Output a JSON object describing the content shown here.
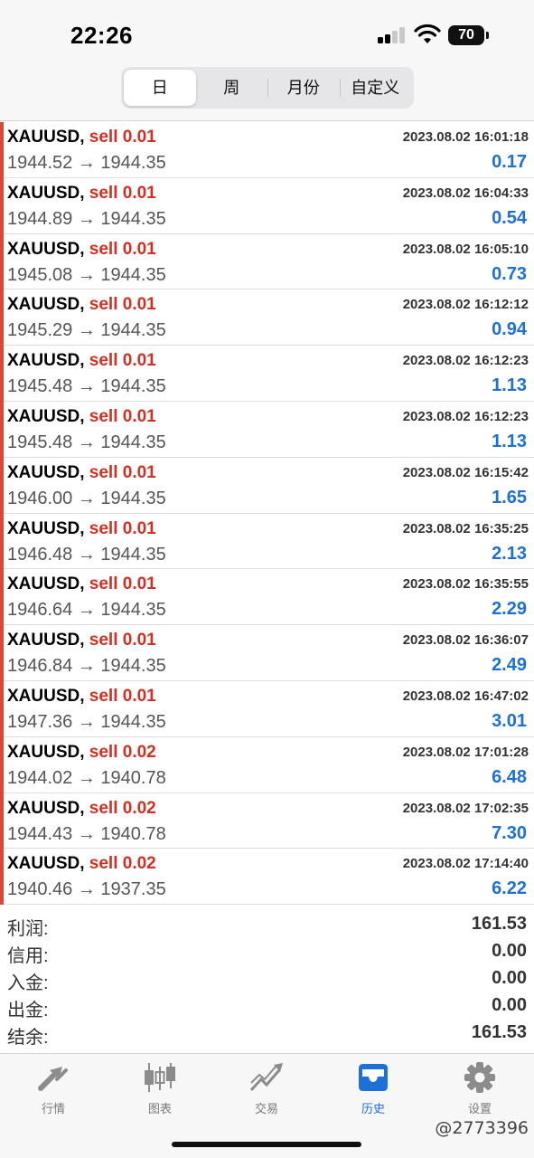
{
  "status_bar": {
    "time": "22:26",
    "battery": "70"
  },
  "period_tabs": [
    {
      "label": "日",
      "active": true
    },
    {
      "label": "周",
      "active": false
    },
    {
      "label": "月份",
      "active": false
    },
    {
      "label": "自定义",
      "active": false
    }
  ],
  "trades": [
    {
      "symbol": "XAUUSD,",
      "side": "sell 0.01",
      "time": "2023.08.02 16:01:18",
      "prices": "1944.52 → 1944.35",
      "profit": "0.17"
    },
    {
      "symbol": "XAUUSD,",
      "side": "sell 0.01",
      "time": "2023.08.02 16:04:33",
      "prices": "1944.89 → 1944.35",
      "profit": "0.54"
    },
    {
      "symbol": "XAUUSD,",
      "side": "sell 0.01",
      "time": "2023.08.02 16:05:10",
      "prices": "1945.08 → 1944.35",
      "profit": "0.73"
    },
    {
      "symbol": "XAUUSD,",
      "side": "sell 0.01",
      "time": "2023.08.02 16:12:12",
      "prices": "1945.29 → 1944.35",
      "profit": "0.94"
    },
    {
      "symbol": "XAUUSD,",
      "side": "sell 0.01",
      "time": "2023.08.02 16:12:23",
      "prices": "1945.48 → 1944.35",
      "profit": "1.13"
    },
    {
      "symbol": "XAUUSD,",
      "side": "sell 0.01",
      "time": "2023.08.02 16:12:23",
      "prices": "1945.48 → 1944.35",
      "profit": "1.13"
    },
    {
      "symbol": "XAUUSD,",
      "side": "sell 0.01",
      "time": "2023.08.02 16:15:42",
      "prices": "1946.00 → 1944.35",
      "profit": "1.65"
    },
    {
      "symbol": "XAUUSD,",
      "side": "sell 0.01",
      "time": "2023.08.02 16:35:25",
      "prices": "1946.48 → 1944.35",
      "profit": "2.13"
    },
    {
      "symbol": "XAUUSD,",
      "side": "sell 0.01",
      "time": "2023.08.02 16:35:55",
      "prices": "1946.64 → 1944.35",
      "profit": "2.29"
    },
    {
      "symbol": "XAUUSD,",
      "side": "sell 0.01",
      "time": "2023.08.02 16:36:07",
      "prices": "1946.84 → 1944.35",
      "profit": "2.49"
    },
    {
      "symbol": "XAUUSD,",
      "side": "sell 0.01",
      "time": "2023.08.02 16:47:02",
      "prices": "1947.36 → 1944.35",
      "profit": "3.01"
    },
    {
      "symbol": "XAUUSD,",
      "side": "sell 0.02",
      "time": "2023.08.02 17:01:28",
      "prices": "1944.02 → 1940.78",
      "profit": "6.48"
    },
    {
      "symbol": "XAUUSD,",
      "side": "sell 0.02",
      "time": "2023.08.02 17:02:35",
      "prices": "1944.43 → 1940.78",
      "profit": "7.30"
    },
    {
      "symbol": "XAUUSD,",
      "side": "sell 0.02",
      "time": "2023.08.02 17:14:40",
      "prices": "1940.46 → 1937.35",
      "profit": "6.22"
    }
  ],
  "summary": [
    {
      "label": "利润:",
      "value": "161.53"
    },
    {
      "label": "信用:",
      "value": "0.00"
    },
    {
      "label": "入金:",
      "value": "0.00"
    },
    {
      "label": "出金:",
      "value": "0.00"
    },
    {
      "label": "结余:",
      "value": "161.53"
    }
  ],
  "tab_bar": [
    {
      "label": "行情",
      "icon": "quotes-arrows-icon",
      "active": false
    },
    {
      "label": "图表",
      "icon": "candlestick-chart-icon",
      "active": false
    },
    {
      "label": "交易",
      "icon": "trade-trend-icon",
      "active": false
    },
    {
      "label": "历史",
      "icon": "history-inbox-icon",
      "active": true
    },
    {
      "label": "设置",
      "icon": "gear-icon",
      "active": false
    }
  ],
  "watermark": "@2773396",
  "colors": {
    "accent": "#1e6fd6",
    "sell": "#d32f22",
    "side_stripe": "#d9473a"
  }
}
